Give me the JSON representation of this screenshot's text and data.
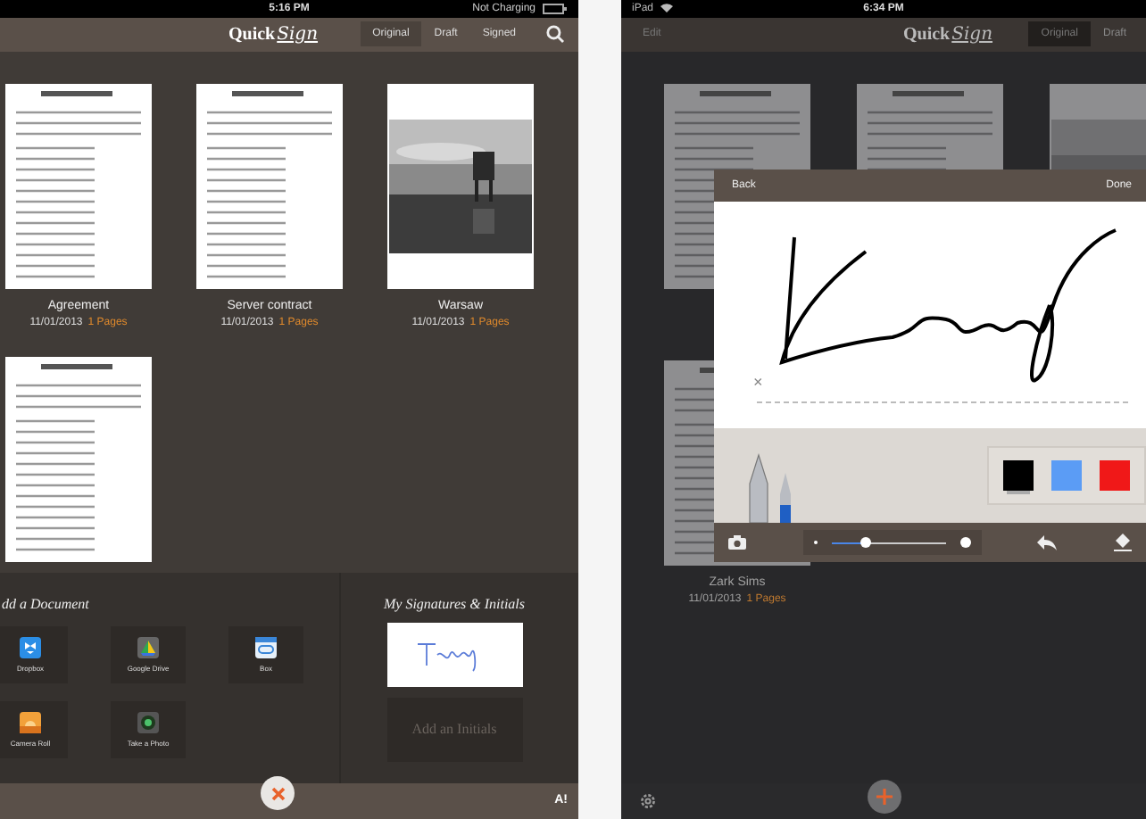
{
  "left_screen": {
    "status_bar": {
      "time": "5:16 PM",
      "battery_text": "Not Charging"
    },
    "nav_bar": {
      "logo": {
        "bold": "Quick",
        "script": "Sign"
      },
      "tabs": [
        {
          "label": "Original",
          "selected": true
        },
        {
          "label": "Draft",
          "selected": false
        },
        {
          "label": "Signed",
          "selected": false
        }
      ]
    },
    "documents": [
      {
        "kind": "document",
        "title": "Agreement",
        "date": "11/01/2013",
        "pages": "1 Pages"
      },
      {
        "kind": "document",
        "title": "Server contract",
        "date": "11/01/2013",
        "pages": "1 Pages"
      },
      {
        "kind": "picture",
        "title": "Warsaw",
        "date": "11/01/2013",
        "pages": "1 Pages"
      },
      {
        "kind": "document"
      }
    ],
    "add_document": {
      "heading": "dd a Document",
      "sources": [
        {
          "kind": "dropbox",
          "label": "Dropbox"
        },
        {
          "kind": "drive",
          "label": "Google Drive"
        },
        {
          "kind": "box",
          "label": "Box"
        },
        {
          "kind": "camera_roll",
          "label": "Camera Roll"
        },
        {
          "label": "Take a Photo"
        }
      ]
    },
    "signatures": {
      "heading": "My Signatures & Initials",
      "add_initials": "Add an Initials"
    },
    "bottom_bar": {
      "font_button": "A!"
    }
  },
  "right_screen": {
    "status_bar": {
      "carrier": "iPad",
      "time": "6:34 PM"
    },
    "nav_bar": {
      "edit": "Edit",
      "logo": {
        "bold": "Quick",
        "script": "Sign"
      },
      "tabs": [
        {
          "label": "Original",
          "selected": true
        },
        {
          "label": "Draft",
          "selected": false
        }
      ]
    },
    "documents": [
      {
        "kind": "document"
      },
      {
        "kind": "document"
      },
      {
        "kind": "picture"
      },
      {
        "kind": "document",
        "title": "Zark Sims",
        "date": "11/01/2013",
        "pages": "1 Pages"
      }
    ],
    "signature_dialog": {
      "back": "Back",
      "done": "Done",
      "clear_mark": "×",
      "colors": [
        {
          "color": "#000000",
          "selected": true
        },
        {
          "color": "#5b9cf5",
          "selected": false
        },
        {
          "color": "#f01818",
          "selected": false
        }
      ],
      "pen_size": {
        "level": 0.3
      }
    }
  }
}
